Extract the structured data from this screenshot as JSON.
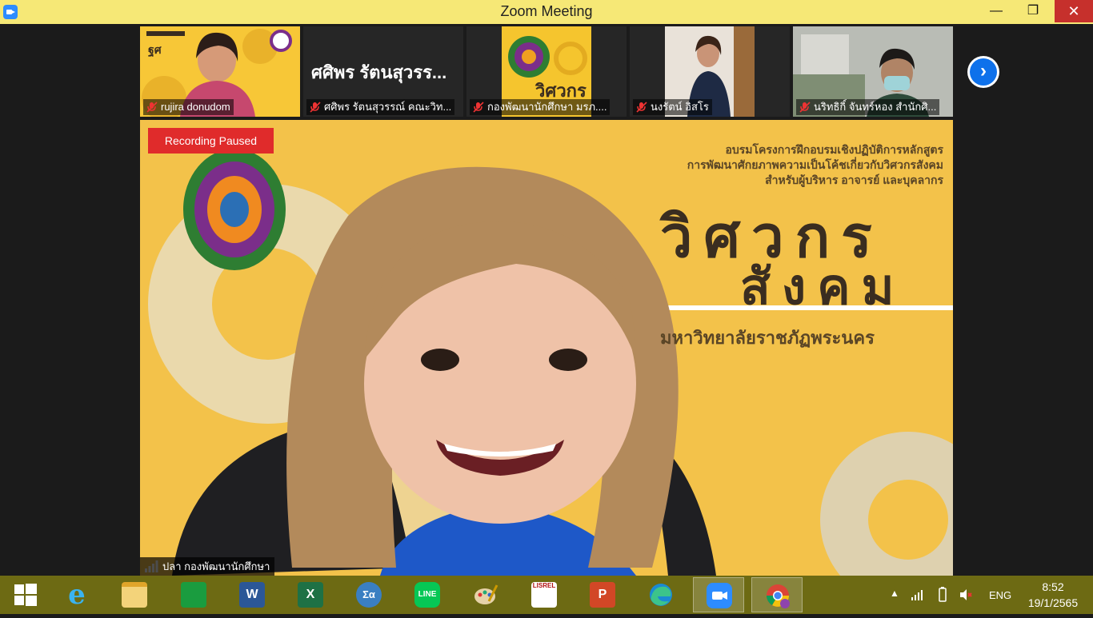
{
  "window": {
    "title": "Zoom Meeting",
    "minimize_glyph": "—",
    "maximize_glyph": "❐",
    "close_glyph": "✕"
  },
  "thumbnails": [
    {
      "name": "rujira donudom",
      "muted": true
    },
    {
      "name": "ศศิพร รัตนสุวรรณ์ คณะวิท...",
      "big_name": "ศศิพร รัตนสุวรร...",
      "muted": true
    },
    {
      "name": "กองพัฒนานักศึกษา มรภ....",
      "muted": true
    },
    {
      "name": "นงรัตน์ อิสโร",
      "muted": true
    },
    {
      "name": "นริทธิกิ์ จันทร์หอง สำนักศิ...",
      "muted": true
    }
  ],
  "next_page_glyph": "›",
  "main": {
    "recording_status": "Recording Paused",
    "speaker_name": "ปลา กองพัฒนานักศึกษา",
    "banner_line1": "อบรมโครงการฝึกอบรมเชิงปฏิบัติการหลักสูตร",
    "banner_line2": "การพัฒนาศักยภาพความเป็นโค้ชเกี่ยวกับวิศวกรสังคม",
    "banner_line3": "สำหรับผู้บริหาร อาจารย์ และบุคลากร",
    "title1": "วิศวกร",
    "title2": "สังคม",
    "university": "มหาวิทยาลัยราชภัฏพระนคร"
  },
  "taskbar": {
    "apps": [
      {
        "icon": "windows-start-icon"
      },
      {
        "icon": "internet-explorer-icon",
        "glyph": "e"
      },
      {
        "icon": "file-explorer-icon"
      },
      {
        "icon": "store-icon"
      },
      {
        "icon": "word-icon",
        "glyph": "W"
      },
      {
        "icon": "excel-icon",
        "glyph": "X"
      },
      {
        "icon": "math-icon",
        "glyph": "Σα"
      },
      {
        "icon": "line-icon",
        "glyph": "LINE"
      },
      {
        "icon": "paint-icon"
      },
      {
        "icon": "lisrel-icon",
        "glyph": "LISREL"
      },
      {
        "icon": "powerpoint-icon",
        "glyph": "P"
      },
      {
        "icon": "edge-icon"
      },
      {
        "icon": "zoom-icon"
      },
      {
        "icon": "chrome-icon"
      }
    ],
    "language": "ENG",
    "time": "8:52",
    "date": "19/1/2565"
  },
  "colors": {
    "titlebar": "#f6e876",
    "taskbar": "#6d6a13",
    "recording_badge": "#e02b2b",
    "accent": "#0e71eb"
  }
}
